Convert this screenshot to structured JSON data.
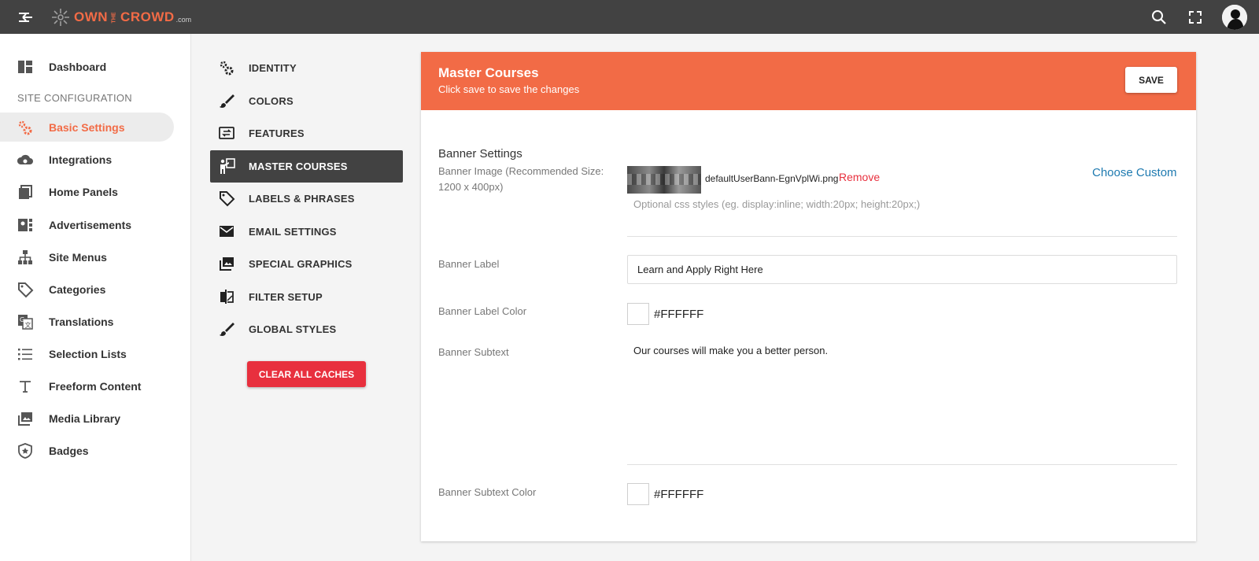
{
  "topbar": {
    "brand": {
      "own": "OWN",
      "the": "THE",
      "crowd": "CROWD",
      "com": ".com"
    },
    "icons": {
      "back": "arrow-back-icon",
      "search": "search-icon",
      "fullscreen": "fullscreen-icon",
      "avatar": "avatar"
    }
  },
  "sidebar": {
    "dashboard": {
      "label": "Dashboard",
      "icon": "dashboard-icon"
    },
    "section_label": "SITE CONFIGURATION",
    "items": [
      {
        "label": "Basic Settings",
        "icon": "gears-icon",
        "active": true
      },
      {
        "label": "Integrations",
        "icon": "cloud-sync-icon"
      },
      {
        "label": "Home Panels",
        "icon": "panels-icon"
      },
      {
        "label": "Advertisements",
        "icon": "ad-icon"
      },
      {
        "label": "Site Menus",
        "icon": "sitemap-icon"
      },
      {
        "label": "Categories",
        "icon": "tag-icon"
      },
      {
        "label": "Translations",
        "icon": "translate-icon"
      },
      {
        "label": "Selection Lists",
        "icon": "list-icon"
      },
      {
        "label": "Freeform Content",
        "icon": "text-icon"
      },
      {
        "label": "Media Library",
        "icon": "images-icon"
      },
      {
        "label": "Badges",
        "icon": "badge-icon"
      }
    ]
  },
  "submenu": {
    "items": [
      {
        "label": "IDENTITY",
        "icon": "gears-icon"
      },
      {
        "label": "COLORS",
        "icon": "brush-icon"
      },
      {
        "label": "FEATURES",
        "icon": "features-icon"
      },
      {
        "label": "MASTER COURSES",
        "icon": "presenter-icon",
        "active": true
      },
      {
        "label": "LABELS & PHRASES",
        "icon": "tags-icon"
      },
      {
        "label": "EMAIL SETTINGS",
        "icon": "email-icon"
      },
      {
        "label": "SPECIAL GRAPHICS",
        "icon": "images-icon"
      },
      {
        "label": "FILTER SETUP",
        "icon": "compare-icon"
      },
      {
        "label": "GLOBAL STYLES",
        "icon": "brush-icon"
      }
    ],
    "clear_caches": "CLEAR ALL CACHES"
  },
  "card": {
    "title": "Master Courses",
    "subtitle": "Click save to save the changes",
    "save": "SAVE",
    "colors": {
      "header": "#F26B46",
      "remove": "#E8303E",
      "link": "#1E7AB0",
      "active_menu": "#424242"
    },
    "banner": {
      "section_title": "Banner Settings",
      "image_label": "Banner Image (Recommended Size: 1200 x 400px)",
      "image_filename": "defaultUserBann-EgnVplWi.png",
      "remove": "Remove",
      "choose_custom": "Choose Custom",
      "css_placeholder": "Optional css styles (eg. display:inline; width:20px; height:20px;)",
      "label_label": "Banner Label",
      "label_value": "Learn and Apply Right Here",
      "label_color_label": "Banner Label Color",
      "label_color_value": "#FFFFFF",
      "subtext_label": "Banner Subtext",
      "subtext_value": "Our courses will make you a better person.",
      "subtext_color_label": "Banner Subtext Color",
      "subtext_color_value": "#FFFFFF"
    }
  }
}
